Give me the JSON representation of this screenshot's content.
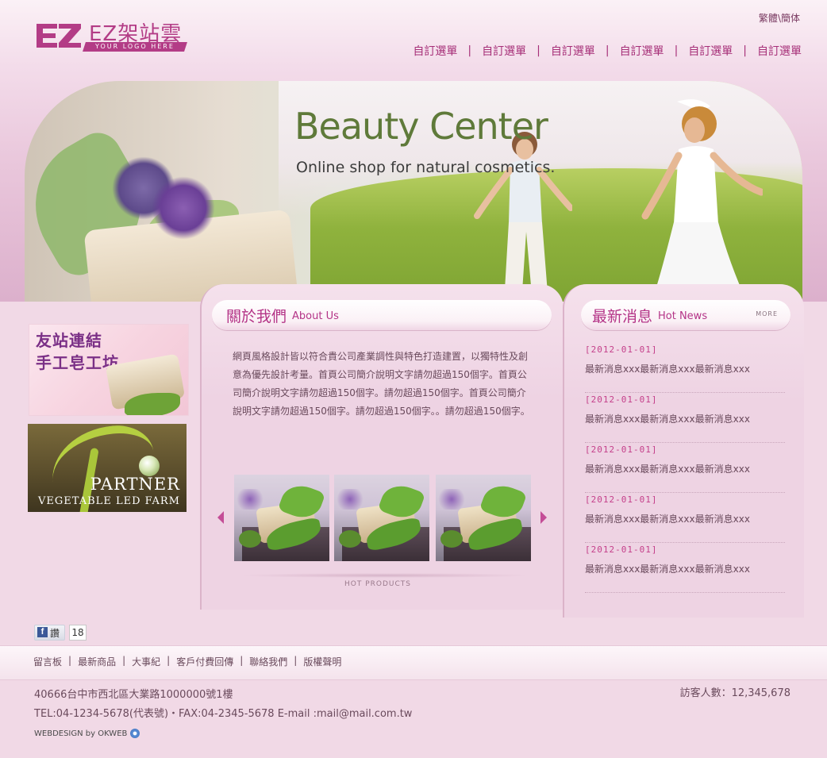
{
  "header": {
    "brand": "EZ架站雲",
    "tagline": "YOUR LOGO HERE",
    "lang_trad": "繁體",
    "lang_sep": "\\",
    "lang_simp": "簡体",
    "nav": [
      "自訂選單",
      "自訂選單",
      "自訂選單",
      "自訂選單",
      "自訂選單",
      "自訂選單"
    ],
    "nav_sep": "|"
  },
  "hero": {
    "title": "Beauty Center",
    "subtitle": "Online shop for natural cosmetics."
  },
  "sidebar": {
    "banner1_line1": "友站連結",
    "banner1_line2": "手工皂工坊",
    "banner2_line1": "PARTNER",
    "banner2_line2": "VEGETABLE LED FARM"
  },
  "about": {
    "title_cn": "關於我們",
    "title_en": "About Us",
    "text": "網頁風格設計皆以符合貴公司產業調性與特色打造建置，以獨特性及創意為優先設計考量。首頁公司簡介說明文字請勿超過150個字。首頁公司簡介說明文字請勿超過150個字。請勿超過150個字。首頁公司簡介說明文字請勿超過150個字。請勿超過150個字。。請勿超過150個字。",
    "hot_products": "HOT PRODUCTS"
  },
  "news": {
    "title_cn": "最新消息",
    "title_en": "Hot News",
    "more": "MORE",
    "items": [
      {
        "date": "[2012-01-01]",
        "text": "最新消息xxx最新消息xxx最新消息xxx"
      },
      {
        "date": "[2012-01-01]",
        "text": "最新消息xxx最新消息xxx最新消息xxx"
      },
      {
        "date": "[2012-01-01]",
        "text": "最新消息xxx最新消息xxx最新消息xxx"
      },
      {
        "date": "[2012-01-01]",
        "text": "最新消息xxx最新消息xxx最新消息xxx"
      },
      {
        "date": "[2012-01-01]",
        "text": "最新消息xxx最新消息xxx最新消息xxx"
      }
    ]
  },
  "social": {
    "like_label": "讚",
    "like_count": "18"
  },
  "footer": {
    "links": [
      "留言板",
      "最新商品",
      "大事紀",
      "客戶付費回傳",
      "聯絡我們",
      "版權聲明"
    ],
    "link_sep": "|",
    "address": "40666台中市西北區大業路1000000號1樓",
    "tel": "TEL:04-1234-5678(代表號)・FAX:04-2345-5678 E-mail :mail@mail.com.tw",
    "visitors": "訪客人數：12,345,678",
    "webdesign": "WEBDESIGN by OKWEB"
  },
  "colors": {
    "accent": "#b43487",
    "text": "#6a4a5c",
    "background": "#f1d9e6"
  }
}
